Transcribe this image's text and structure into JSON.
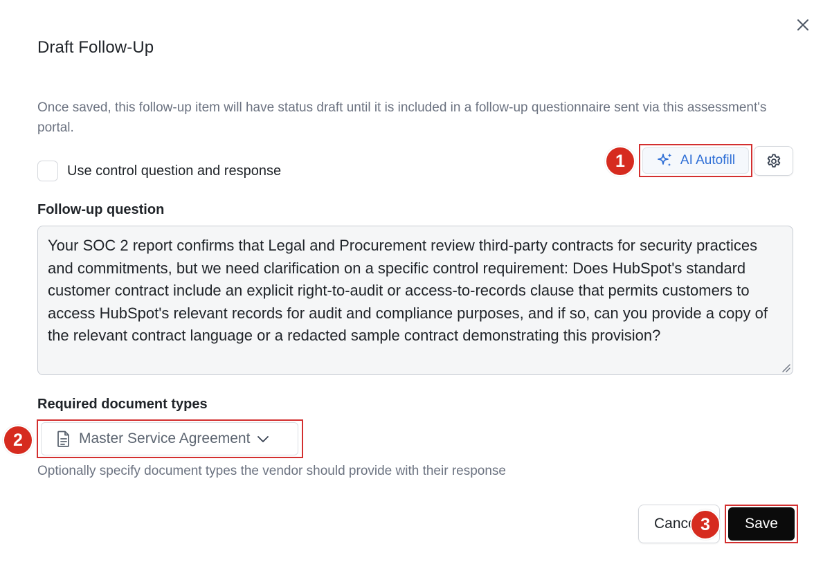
{
  "dialog": {
    "title": "Draft Follow-Up",
    "description": "Once saved, this follow-up item will have status draft until it is included in a follow-up questionnaire sent via this assessment's portal.",
    "close_icon": "close-icon"
  },
  "checkbox": {
    "label": "Use control question and response",
    "checked": false
  },
  "ai_autofill": {
    "label": "AI Autofill",
    "icon": "sparkles-icon",
    "accent": "#2f6fd6"
  },
  "settings": {
    "icon": "gear-icon"
  },
  "followup": {
    "label": "Follow-up question",
    "value": "Your SOC 2 report confirms that Legal and Procurement review third-party contracts for security practices and commitments, but we need clarification on a specific control requirement: Does HubSpot's standard customer contract include an explicit right-to-audit or access-to-records clause that permits customers to access HubSpot's relevant records for audit and compliance purposes, and if so, can you provide a copy of the relevant contract language or a redacted sample contract demonstrating this provision?"
  },
  "documents": {
    "label": "Required document types",
    "selected": "Master Service Agreement",
    "icon": "document-icon",
    "hint": "Optionally specify document types the vendor should provide with their response"
  },
  "footer": {
    "cancel_label": "Cancel",
    "save_label": "Save"
  },
  "annotations": {
    "marker_1": "1",
    "marker_2": "2",
    "marker_3": "3",
    "highlight_color": "#d32f2f"
  }
}
